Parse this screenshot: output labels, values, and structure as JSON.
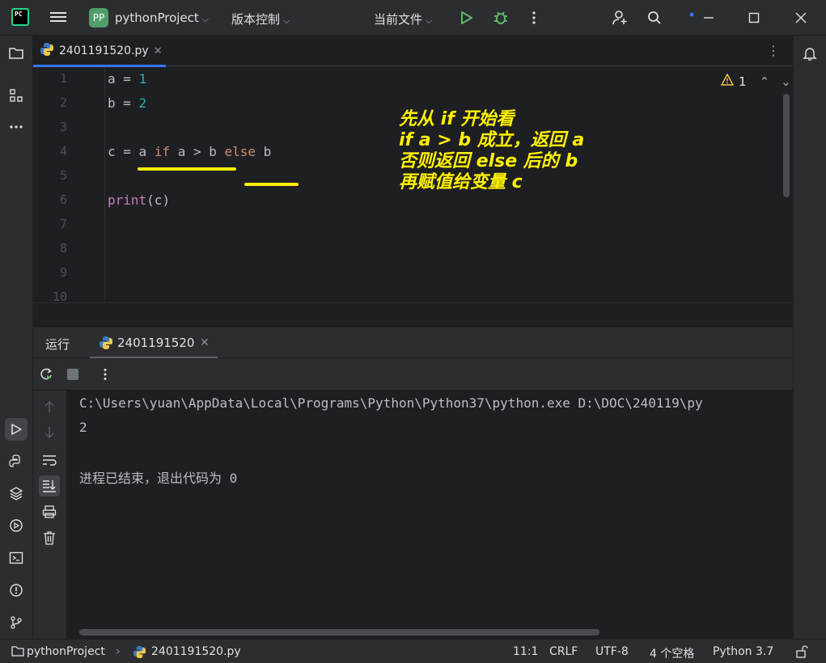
{
  "titlebar": {
    "logo_text": "PC",
    "project_badge": "PP",
    "project_name": "pythonProject",
    "vcs_label": "版本控制",
    "current_file_label": "当前文件"
  },
  "editor": {
    "tab_label": "2401191520.py",
    "warning_count": "1",
    "line_numbers": [
      "1",
      "2",
      "3",
      "4",
      "5",
      "6",
      "7",
      "8",
      "9",
      "10"
    ],
    "lines": {
      "l1": {
        "var": "a",
        "op": " = ",
        "val": "1"
      },
      "l2": {
        "var": "b",
        "op": " = ",
        "val": "2"
      },
      "l4": {
        "pre": "c = a ",
        "kw_if": "if",
        "mid": " a > b ",
        "kw_else": "else",
        "post": " b"
      },
      "l6": {
        "fn": "print",
        "args": "(c)"
      }
    },
    "annotation": [
      "先从 if 开始看",
      "if a > b 成立，返回 a",
      "否则返回 else 后的 b",
      "再赋值给变量 c"
    ],
    "annotation_color": "#fff200"
  },
  "run_panel": {
    "label": "运行",
    "tab_name": "2401191520",
    "console_lines": [
      "C:\\Users\\yuan\\AppData\\Local\\Programs\\Python\\Python37\\python.exe D:\\DOC\\240119\\py",
      "2",
      "",
      "进程已结束，退出代码为 0"
    ]
  },
  "statusbar": {
    "project": "pythonProject",
    "file": "2401191520.py",
    "position": "11:1",
    "line_sep": "CRLF",
    "encoding": "UTF-8",
    "indent": "4 个空格",
    "interpreter": "Python 3.7"
  },
  "icons": {
    "run": "run-icon",
    "debug": "debug-icon",
    "search": "search-icon",
    "add_user": "add-user-icon"
  },
  "colors": {
    "accent": "#3574f0",
    "run_green": "#5fb865",
    "number": "#2aacb8",
    "keyword": "#cf8e6d",
    "builtin": "#c77dbb"
  }
}
